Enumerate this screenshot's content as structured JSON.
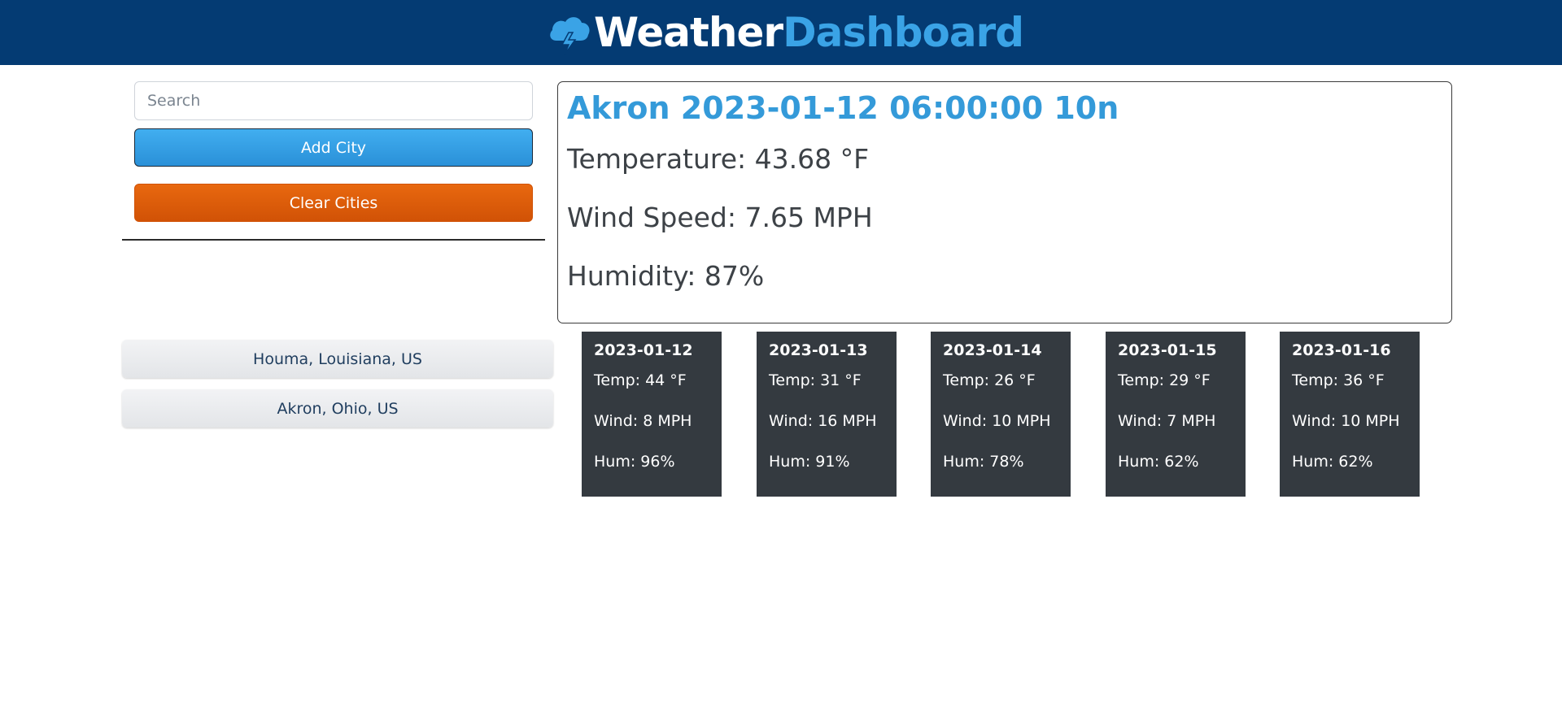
{
  "header": {
    "brand_weather": "Weather",
    "brand_dashboard": "Dashboard",
    "icon": "cloud-lightning-icon",
    "colors": {
      "bar": "#043b73",
      "weather": "#ffffff",
      "dashboard": "#3aa3e6"
    }
  },
  "sidebar": {
    "search_placeholder": "Search",
    "search_value": "",
    "add_city_label": "Add City",
    "clear_cities_label": "Clear Cities",
    "cities": [
      "Houma, Louisiana, US",
      "Akron, Ohio, US"
    ],
    "colors": {
      "add": "#349ad9",
      "clear": "#df5d0a"
    }
  },
  "current": {
    "title": "Akron 2023-01-12 06:00:00 10n",
    "temperature": "Temperature: 43.68 °F",
    "wind": "Wind Speed: 7.65 MPH",
    "humidity": "Humidity: 87%",
    "colors": {
      "title": "#349ad9"
    }
  },
  "forecast": [
    {
      "date": "2023-01-12",
      "temp": "Temp: 44 °F",
      "wind": "Wind: 8 MPH",
      "hum": "Hum: 96%"
    },
    {
      "date": "2023-01-13",
      "temp": "Temp: 31 °F",
      "wind": "Wind: 16 MPH",
      "hum": "Hum: 91%"
    },
    {
      "date": "2023-01-14",
      "temp": "Temp: 26 °F",
      "wind": "Wind: 10 MPH",
      "hum": "Hum: 78%"
    },
    {
      "date": "2023-01-15",
      "temp": "Temp: 29 °F",
      "wind": "Wind: 7 MPH",
      "hum": "Hum: 62%"
    },
    {
      "date": "2023-01-16",
      "temp": "Temp: 36 °F",
      "wind": "Wind: 10 MPH",
      "hum": "Hum: 62%"
    }
  ]
}
